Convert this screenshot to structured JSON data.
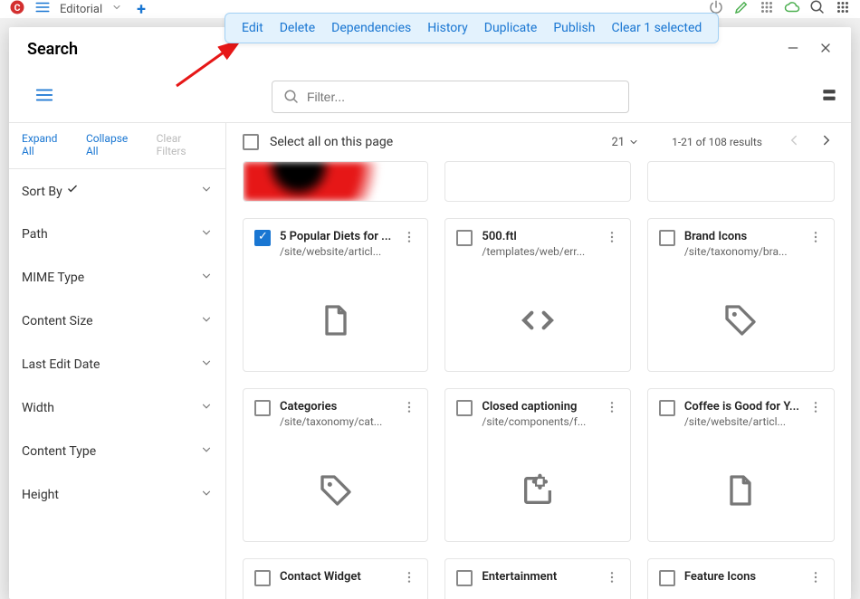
{
  "top": {
    "label": "Editorial"
  },
  "actions": {
    "edit": "Edit",
    "delete": "Delete",
    "dependencies": "Dependencies",
    "history": "History",
    "duplicate": "Duplicate",
    "publish": "Publish",
    "clear": "Clear 1 selected"
  },
  "modal": {
    "title": "Search"
  },
  "filter": {
    "placeholder": "Filter..."
  },
  "sidebar": {
    "expand": "Expand All",
    "collapse": "Collapse All",
    "clear": "Clear Filters",
    "items": [
      {
        "label": "Sort By",
        "active": true
      },
      {
        "label": "Path"
      },
      {
        "label": "MIME Type"
      },
      {
        "label": "Content Size"
      },
      {
        "label": "Last Edit Date"
      },
      {
        "label": "Width"
      },
      {
        "label": "Content Type"
      },
      {
        "label": "Height"
      }
    ]
  },
  "content_header": {
    "select_all": "Select all on this page",
    "page_size": "21",
    "results": "1-21 of 108 results"
  },
  "cards": [
    {
      "title": "5 Popular Diets for ...",
      "path": "/site/website/articl...",
      "icon": "file",
      "checked": true
    },
    {
      "title": "500.ftl",
      "path": "/templates/web/err...",
      "icon": "code",
      "checked": false
    },
    {
      "title": "Brand Icons",
      "path": "/site/taxonomy/bra...",
      "icon": "tag",
      "checked": false
    },
    {
      "title": "Categories",
      "path": "/site/taxonomy/cat...",
      "icon": "tag",
      "checked": false
    },
    {
      "title": "Closed captioning",
      "path": "/site/components/f...",
      "icon": "ext",
      "checked": false
    },
    {
      "title": "Coffee is Good for Y...",
      "path": "/site/website/articl...",
      "icon": "file",
      "checked": false
    },
    {
      "title": "Contact Widget",
      "path": "",
      "icon": "",
      "checked": false,
      "short": true
    },
    {
      "title": "Entertainment",
      "path": "",
      "icon": "",
      "checked": false,
      "short": true
    },
    {
      "title": "Feature Icons",
      "path": "",
      "icon": "",
      "checked": false,
      "short": true
    }
  ]
}
